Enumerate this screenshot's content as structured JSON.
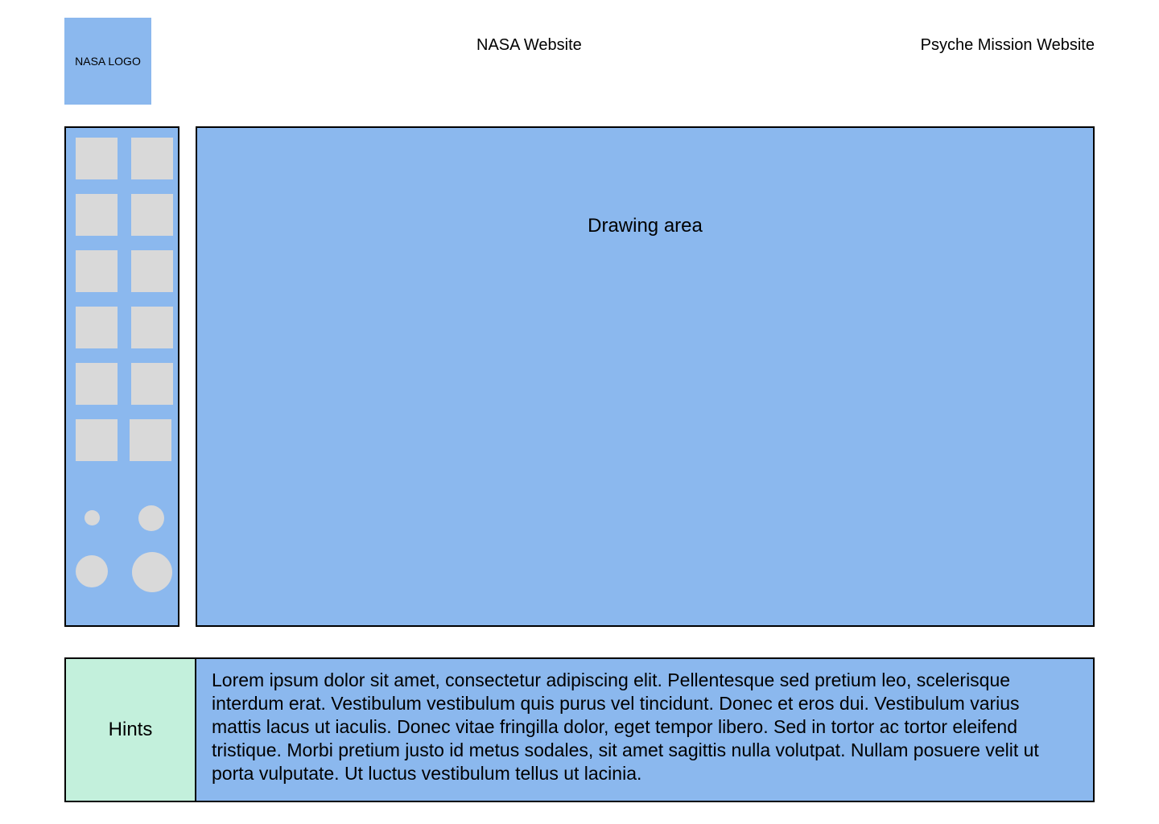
{
  "header": {
    "logo_text": "NASA LOGO",
    "nasa_link": "NASA Website",
    "psyche_link": "Psyche Mission Website"
  },
  "toolbar": {
    "tool_count": 12,
    "brush_sizes": [
      "extra-small",
      "small",
      "medium",
      "large"
    ]
  },
  "canvas": {
    "label": "Drawing area"
  },
  "hints": {
    "label": "Hints",
    "text": "Lorem ipsum dolor sit amet, consectetur adipiscing elit. Pellentesque sed pretium leo, scelerisque interdum erat. Vestibulum vestibulum quis purus vel tincidunt. Donec et eros dui. Vestibulum varius mattis lacus ut iaculis. Donec vitae fringilla dolor, eget tempor libero. Sed in tortor ac tortor eleifend tristique. Morbi pretium justo id metus sodales, sit amet sagittis nulla volutpat. Nullam posuere velit ut porta vulputate. Ut luctus vestibulum tellus ut lacinia."
  },
  "colors": {
    "panel_blue": "#8bb8ee",
    "hints_green": "#c3f0dc",
    "tool_gray": "#d9d9d9",
    "border": "#000000"
  }
}
